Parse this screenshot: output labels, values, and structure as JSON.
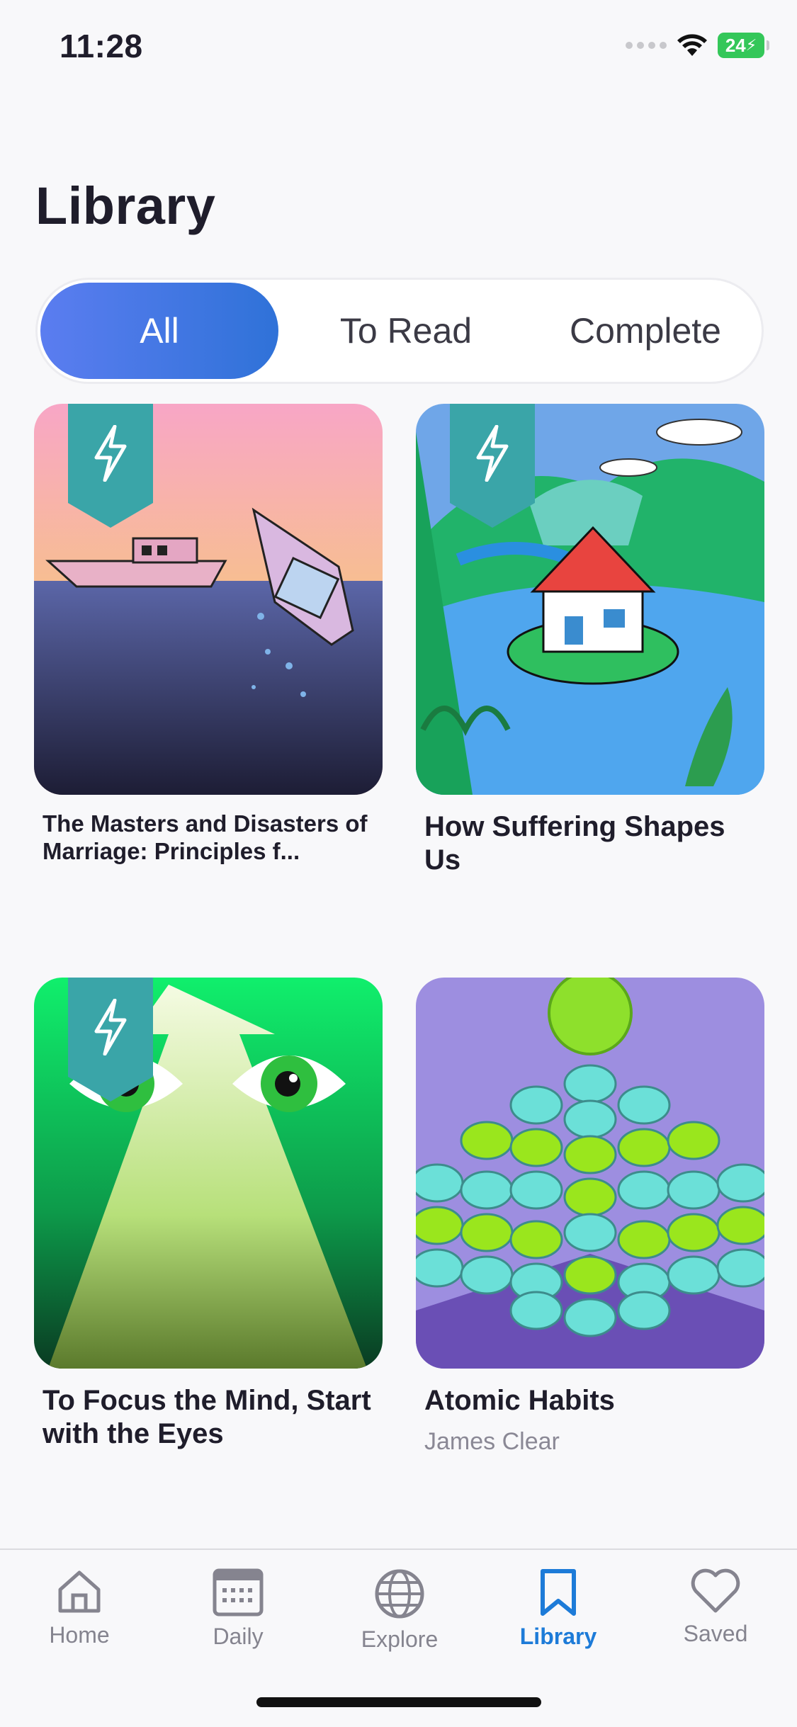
{
  "status_bar": {
    "time": "11:28",
    "battery": "24"
  },
  "page": {
    "title": "Library"
  },
  "filter_tabs": [
    {
      "label": "All",
      "selected": true
    },
    {
      "label": "To Read",
      "selected": false
    },
    {
      "label": "Complete",
      "selected": false
    }
  ],
  "books": [
    {
      "title": "The Masters and Disasters of Marriage: Principles f...",
      "author": "",
      "icon": "bolt-icon"
    },
    {
      "title": "How Suffering Shapes Us",
      "author": "",
      "icon": "bolt-icon"
    },
    {
      "title": "To Focus the Mind, Start with the Eyes",
      "author": "",
      "icon": "bolt-icon"
    },
    {
      "title": "Atomic Habits",
      "author": "James Clear"
    }
  ],
  "tab_bar": [
    {
      "label": "Home",
      "icon": "home-icon"
    },
    {
      "label": "Daily",
      "icon": "calendar-icon"
    },
    {
      "label": "Explore",
      "icon": "globe-icon"
    },
    {
      "label": "Library",
      "icon": "bookmark-icon",
      "active": true
    },
    {
      "label": "Saved",
      "icon": "heart-icon"
    }
  ],
  "colors": {
    "accent": "#2f72d8",
    "bookmark": "#3aa5a8",
    "inactive": "#85848f"
  }
}
